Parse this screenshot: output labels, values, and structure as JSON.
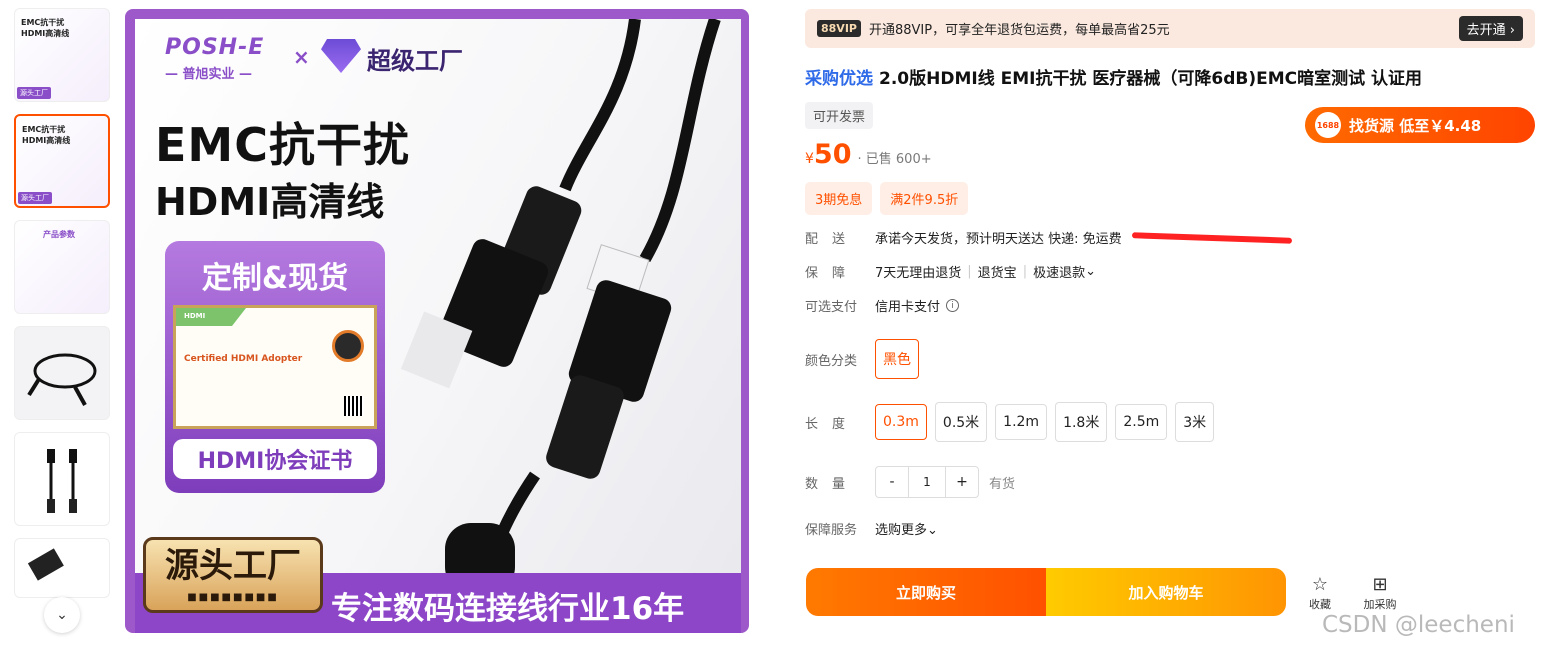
{
  "thumbnails": {
    "items": [
      {
        "line1": "EMC抗干扰",
        "line2": "HDMI高清线",
        "badge": "源头工厂"
      },
      {
        "line1": "EMC抗干扰",
        "line2": "HDMI高清线",
        "badge": "源头工厂"
      },
      {
        "line1": "产品参数",
        "line2": "",
        "badge": ""
      },
      {
        "line1": "",
        "line2": "",
        "badge": ""
      },
      {
        "line1": "",
        "line2": "",
        "badge": ""
      },
      {
        "line1": "",
        "line2": "",
        "badge": ""
      }
    ],
    "selected_index": 1
  },
  "main_image": {
    "brand": "POSH-E",
    "brand_sub": "— 普旭实业 —",
    "cross": "×",
    "partner": "超级工厂",
    "headline1": "EMC抗干扰",
    "headline2": "HDMI高清线",
    "cert_title": "定制&现货",
    "cert_paper_head": "HDMI",
    "cert_paper_title": "Certified HDMI Adopter",
    "cert_footer": "HDMI协会证书",
    "source_tag": "源头工厂",
    "slogan": "专注数码连接线行业16年"
  },
  "vip": {
    "badge": "88VIP",
    "text": "开通88VIP，可享全年退货包运费，每单最高省25元",
    "button": "去开通 ›"
  },
  "product": {
    "tag": "采购优选",
    "title": "2.0版HDMI线 EMI抗干扰 医疗器械（可降6dB)EMC暗室测试 认证用",
    "invoice": "可开发票",
    "currency": "¥",
    "price": "50",
    "sold": "· 已售 600+"
  },
  "find_source": {
    "icon_text": "1688",
    "label": "找货源 低至￥4.48"
  },
  "coupons": [
    "3期免息",
    "满2件9.5折"
  ],
  "delivery": {
    "label": "配送",
    "text": "承诺今天发货，预计明天送达  快递: 免运费"
  },
  "guarantee": {
    "label": "保障",
    "items": [
      "7天无理由退货",
      "退货宝",
      "极速退款"
    ],
    "more": "⌄"
  },
  "payment": {
    "label": "可选支付",
    "text": "信用卡支付",
    "info": "i"
  },
  "color": {
    "label": "颜色分类",
    "options": [
      "黑色"
    ],
    "selected": 0
  },
  "length": {
    "label": "长度",
    "options": [
      "0.3m",
      "0.5米",
      "1.2m",
      "1.8米",
      "2.5m",
      "3米"
    ],
    "selected": 0
  },
  "quantity": {
    "label": "数量",
    "minus": "-",
    "value": "1",
    "plus": "+",
    "stock": "有货"
  },
  "service": {
    "label": "保障服务",
    "text": "选购更多⌄"
  },
  "actions": {
    "buy": "立即购买",
    "cart": "加入购物车",
    "favorite": "收藏",
    "favorite_icon": "☆",
    "purchase": "加采购",
    "purchase_icon": "⊞"
  },
  "scroll_down": "⌄",
  "watermark": "CSDN @leecheni",
  "colors": {
    "accent": "#ff5000",
    "brand_purple": "#8a4fc8",
    "tag_blue": "#2f6be8"
  }
}
